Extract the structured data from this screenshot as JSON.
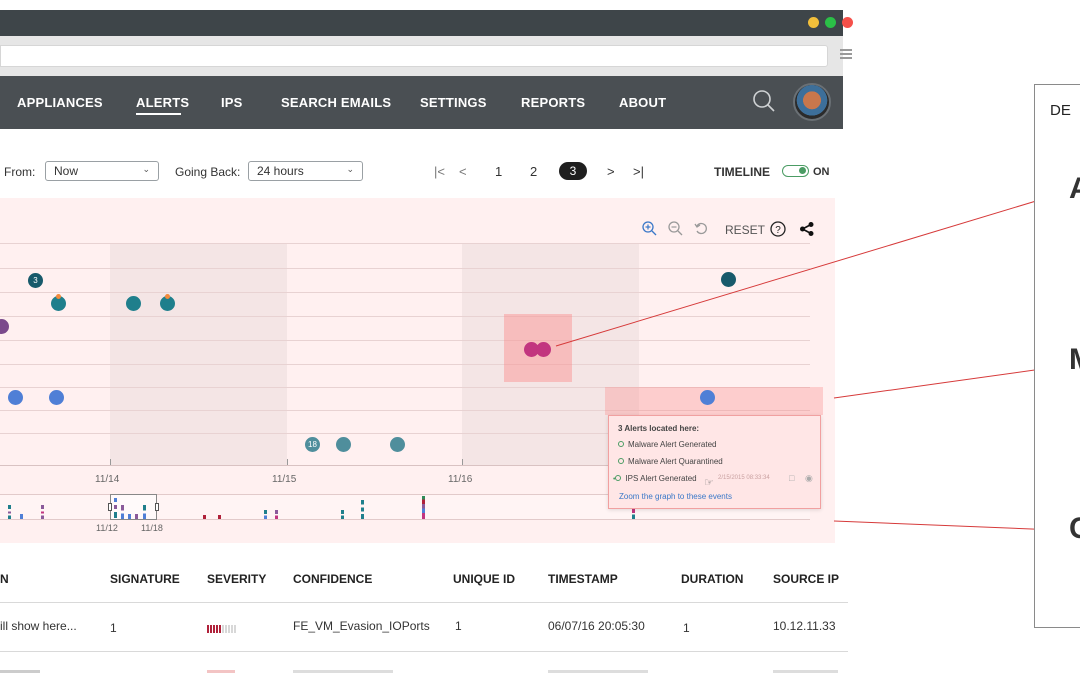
{
  "window": {
    "traffic_lights": [
      "#f2bf3b",
      "#2bbf47",
      "#f5504a"
    ]
  },
  "nav": {
    "items": [
      {
        "label": "APPLIANCES"
      },
      {
        "label": "ALERTS",
        "active": true
      },
      {
        "label": "IPS"
      },
      {
        "label": "SEARCH EMAILS"
      },
      {
        "label": "SETTINGS"
      },
      {
        "label": "REPORTS"
      },
      {
        "label": "ABOUT"
      }
    ],
    "icons": [
      "search-icon",
      "avatar"
    ]
  },
  "filters": {
    "from_label": "From:",
    "from_value": "Now",
    "going_back_label": "Going Back:",
    "going_back_value": "24 hours"
  },
  "pagination": {
    "first": "|<",
    "prev": "<",
    "pages": [
      "1",
      "2",
      "3"
    ],
    "current": "3",
    "next": ">",
    "last": ">|"
  },
  "timeline": {
    "label": "TIMELINE",
    "state": "ON",
    "toggle_color": "#4b9c64"
  },
  "chart_toolbar": {
    "reset_label": "RESET",
    "icons": [
      "zoom-in-icon",
      "zoom-out-icon",
      "undo-icon",
      "help-icon",
      "share-icon"
    ]
  },
  "chart_data": {
    "type": "scatter",
    "x_ticks": [
      "11/14",
      "11/15",
      "11/16"
    ],
    "minimap_ticks": [
      "11/12",
      "11/18"
    ],
    "cluster_labels": [
      "3",
      "18"
    ],
    "colors": {
      "teal": "#1f7f8c",
      "dark_teal": "#185a6b",
      "blue": "#4f7fd6",
      "purple": "#7b4a8c",
      "magenta": "#c2357f",
      "gray_teal": "#4f8e9c",
      "orange": "#f28a3c"
    }
  },
  "popup": {
    "title": "3 Alerts located here:",
    "items": [
      {
        "label": "Malware Alert Generated"
      },
      {
        "label": "Malware Alert Quarantined"
      },
      {
        "label": "IPS Alert Generated",
        "time": "2/15/2015 08:33:34"
      }
    ],
    "link": "Zoom the graph to these events"
  },
  "table": {
    "columns": [
      "N",
      "SIGNATURE",
      "SEVERITY",
      "CONFIDENCE",
      "UNIQUE ID",
      "TIMESTAMP",
      "DURATION",
      "SOURCE IP"
    ],
    "rows": [
      {
        "name": "ill show here...",
        "signature": "1",
        "severity_level": 5,
        "confidence": "FE_VM_Evasion_IOPorts",
        "unique_id": "1",
        "timestamp": "06/07/16  20:05:30",
        "duration": "1",
        "source_ip": "10.12.11.33"
      }
    ]
  },
  "annotation": {
    "title": "DE",
    "letters": [
      "A",
      "M",
      "C"
    ]
  }
}
